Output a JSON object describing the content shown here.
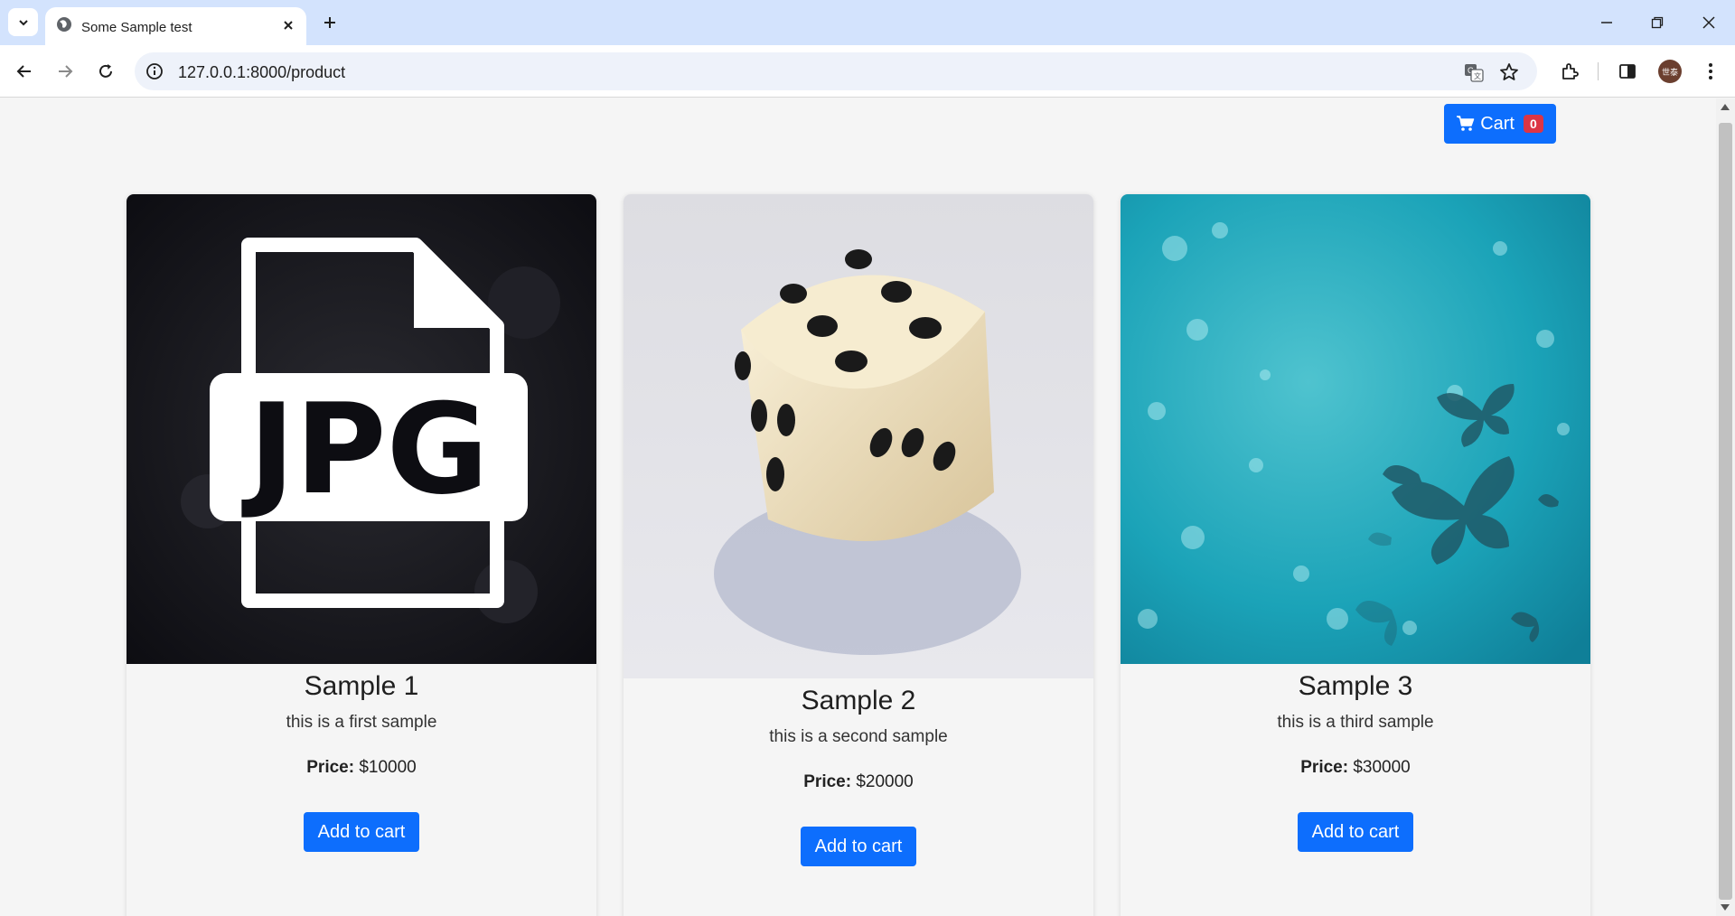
{
  "browser": {
    "tab_title": "Some Sample test",
    "url": "127.0.0.1:8000/product",
    "profile_initials": "世泰"
  },
  "header": {
    "cart_label": "Cart",
    "cart_count": "0"
  },
  "products": [
    {
      "name": "Sample 1",
      "description": "this is a first sample",
      "price_label": "Price:",
      "price_value": "$10000",
      "button_label": "Add to cart",
      "image": "jpg-file-icon"
    },
    {
      "name": "Sample 2",
      "description": "this is a second sample",
      "price_label": "Price:",
      "price_value": "$20000",
      "button_label": "Add to cart",
      "image": "dice"
    },
    {
      "name": "Sample 3",
      "description": "this is a third sample",
      "price_label": "Price:",
      "price_value": "$30000",
      "button_label": "Add to cart",
      "image": "teal-butterflies"
    }
  ],
  "colors": {
    "primary": "#0d6efd",
    "badge": "#dc3545",
    "tabbar": "#d3e3fd"
  }
}
